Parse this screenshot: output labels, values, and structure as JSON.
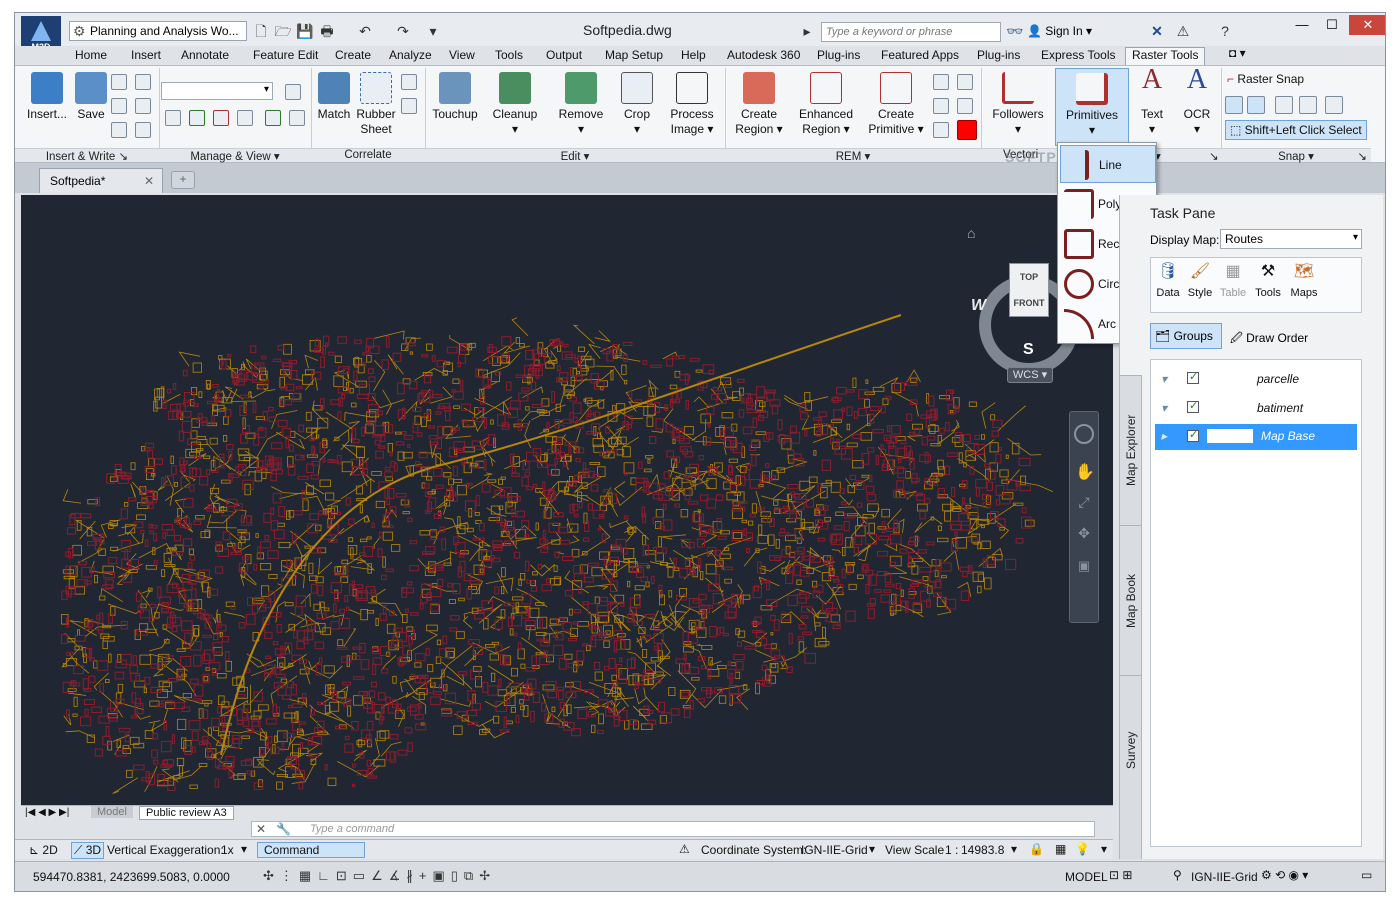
{
  "app": {
    "logo_text": "M3D",
    "workspace": "Planning and Analysis Wo...",
    "document_title": "Softpedia.dwg"
  },
  "search": {
    "placeholder": "Type a keyword or phrase"
  },
  "account": {
    "sign_in": "Sign In"
  },
  "menu_tabs": [
    "Home",
    "Insert",
    "Annotate",
    "Feature Edit",
    "Create",
    "Analyze",
    "View",
    "Tools",
    "Output",
    "Map Setup",
    "Help",
    "Autodesk 360",
    "Plug-ins",
    "Featured Apps",
    "Plug-ins",
    "Express Tools",
    "Raster Tools"
  ],
  "active_tab": "Raster Tools",
  "ribbon": {
    "buttons": {
      "insert": "Insert...",
      "save": "Save",
      "match": "Match",
      "rubber": "Rubber Sheet",
      "touchup": "Touchup",
      "cleanup": "Cleanup",
      "remove": "Remove",
      "crop": "Crop",
      "process": "Process Image",
      "create_region": "Create Region",
      "enhanced_region": "Enhanced Region",
      "create_primitive": "Create Primitive",
      "followers": "Followers",
      "primitives": "Primitives",
      "text": "Text",
      "ocr": "OCR",
      "raster_snap": "Raster Snap",
      "shift_select": "Shift+Left Click Select"
    },
    "panels": {
      "insert_write": "Insert & Write",
      "manage_view": "Manage & View",
      "correlate": "Correlate",
      "edit": "Edit",
      "rem": "REM",
      "vectorize": "Vectori",
      "t": "t",
      "snap": "Snap"
    }
  },
  "primitives_menu": [
    "Line",
    "Polyline",
    "Rectangle",
    "Circle",
    "Arc"
  ],
  "document_tab": "Softpedia*",
  "viewcube": {
    "top": "TOP",
    "front": "FRONT",
    "west": "W",
    "south": "S",
    "wcs": "WCS"
  },
  "task_pane": {
    "title": "Task Pane",
    "display_map_label": "Display Map:",
    "display_map_value": "Routes",
    "tools": [
      "Data",
      "Style",
      "Table",
      "Tools",
      "Maps"
    ],
    "groups_label": "Groups",
    "draw_order_label": "Draw Order",
    "layers": [
      "parcelle",
      "batiment",
      "Map Base"
    ],
    "side_tabs": [
      "Map Explorer",
      "Map Book",
      "Survey"
    ]
  },
  "layout_tabs": [
    "Model",
    "Public review A3"
  ],
  "command": {
    "placeholder": "Type a command"
  },
  "status": {
    "2d": "2D",
    "3d": "3D",
    "vertical_exaggeration_label": "Vertical Exaggeration:",
    "vertical_exaggeration_value": "1x",
    "command_label": "Command",
    "coord_system_label": "Coordinate System:",
    "coord_system_value": "IGN-IIE-Grid",
    "view_scale_label": "View Scale",
    "view_scale_prefix": "1 :",
    "view_scale_value": "14983.8"
  },
  "coords": {
    "readout": "594470.8381, 2423699.5083, 0.0000",
    "model": "MODEL",
    "grid": "IGN-IIE-Grid"
  },
  "watermark": "SOFTPEDIA"
}
